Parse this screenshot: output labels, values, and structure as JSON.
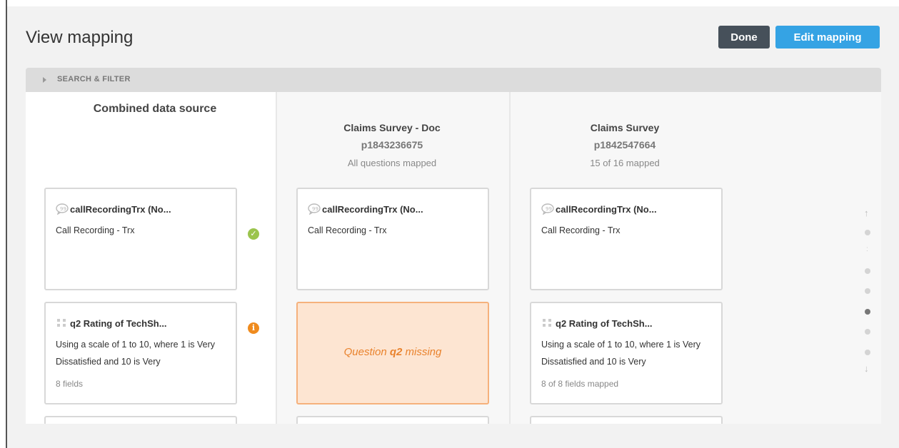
{
  "header": {
    "title": "View mapping",
    "done_label": "Done",
    "edit_label": "Edit mapping"
  },
  "search_filter": {
    "label": "SEARCH & FILTER"
  },
  "columns": {
    "combined": {
      "title": "Combined data source"
    },
    "source1": {
      "title": "Claims Survey - Doc",
      "id": "p1843236675",
      "status": "All questions mapped"
    },
    "source2": {
      "title": "Claims Survey",
      "id": "p1842547664",
      "status": "15 of 16 mapped"
    }
  },
  "combined_cards": [
    {
      "title": "callRecordingTrx (No...",
      "text": "Call Recording - Trx",
      "icon": "speech-bubble-icon",
      "status": "mapped-check"
    },
    {
      "title": "q2 Rating of TechSh...",
      "text": "Using a scale of 1 to 10, where 1 is Very Dissatisfied and 10 is Very",
      "sub": "8 fields",
      "icon": "grid-icon",
      "status": "info"
    }
  ],
  "source1_cards": [
    {
      "title": "callRecordingTrx (No...",
      "text": "Call Recording - Trx",
      "icon": "speech-bubble-icon"
    },
    {
      "missing_prefix": "Question ",
      "missing_q": "q2",
      "missing_suffix": " missing"
    }
  ],
  "source2_cards": [
    {
      "title": "callRecordingTrx (No...",
      "text": "Call Recording - Trx",
      "icon": "speech-bubble-icon"
    },
    {
      "title": "q2 Rating of TechSh...",
      "text": "Using a scale of 1 to 10, where 1 is Very Dissatisfied and 10 is Very",
      "sub": "8 of 8 fields mapped",
      "icon": "grid-icon"
    }
  ],
  "colors": {
    "done_bg": "#46505a",
    "edit_bg": "#35a3e4",
    "check_green": "#9bc44d",
    "info_orange": "#ef8b1e",
    "missing_bg": "#fde5d2",
    "missing_text": "#e9822c"
  },
  "pager": {
    "active_index": 4,
    "dot_count": 7
  }
}
